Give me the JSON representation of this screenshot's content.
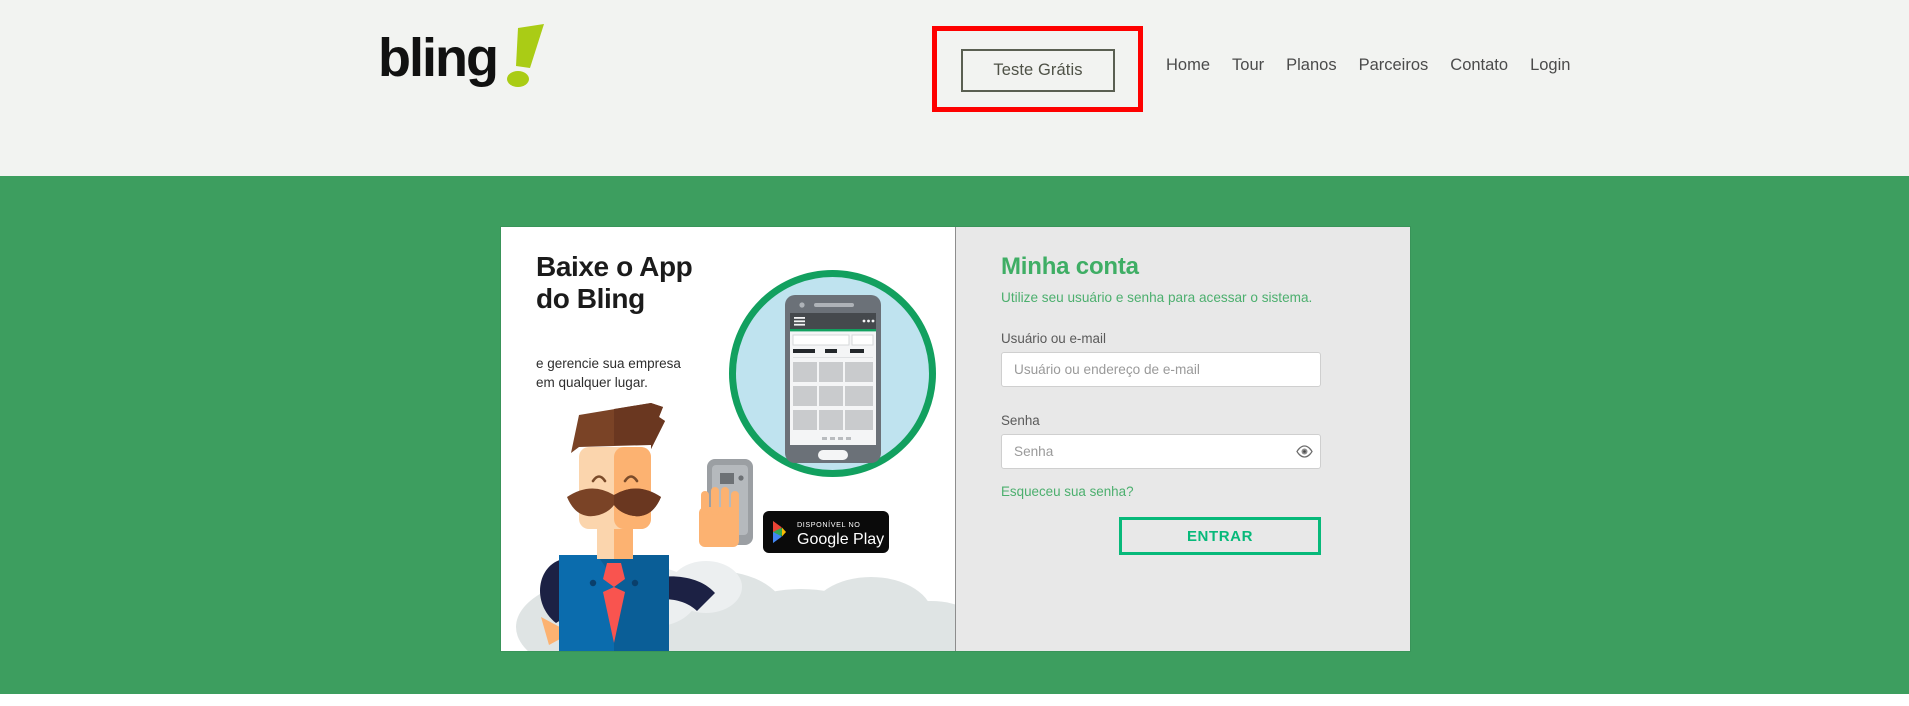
{
  "header": {
    "logo_text": "bling",
    "logo_mark": "exclamation-mark",
    "cta_label": "Teste Grátis",
    "nav_items": [
      {
        "label": "Home"
      },
      {
        "label": "Tour"
      },
      {
        "label": "Planos"
      },
      {
        "label": "Parceiros"
      },
      {
        "label": "Contato"
      },
      {
        "label": "Login"
      }
    ],
    "highlight_color": "#fe0000",
    "background_color": "#f2f3f1"
  },
  "band": {
    "background_color": "#3d9e5f"
  },
  "promo": {
    "title_line1": "Baixe o App",
    "title_line2": "do Bling",
    "subtitle_line1": "e gerencie sua empresa",
    "subtitle_line2": "em qualquer lugar.",
    "store_badge": {
      "small_text": "DISPONÍVEL NO",
      "big_text": "Google Play"
    },
    "circle_ring_color": "#12a05f",
    "circle_fill_color": "#bfe3ef"
  },
  "login": {
    "title": "Minha conta",
    "subtitle": "Utilize seu usuário e senha para acessar o sistema.",
    "username": {
      "label": "Usuário ou e-mail",
      "placeholder": "Usuário ou endereço de e-mail",
      "value": ""
    },
    "password": {
      "label": "Senha",
      "placeholder": "Senha",
      "value": "",
      "toggle_icon": "eye-icon"
    },
    "forgot_label": "Esqueceu sua senha?",
    "submit_label": "ENTRAR",
    "accent_color": "#07b97a",
    "title_color": "#3fae65",
    "panel_color": "#e8e8e8"
  }
}
